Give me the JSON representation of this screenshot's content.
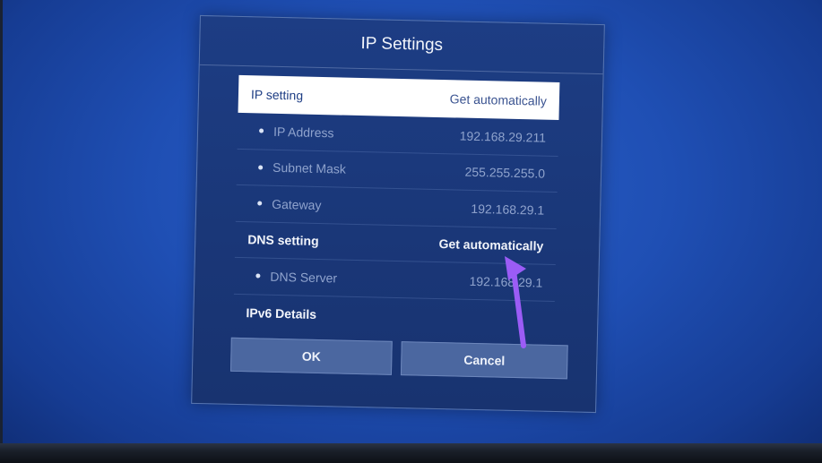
{
  "dialog": {
    "title": "IP Settings",
    "rows": [
      {
        "label": "IP setting",
        "value": "Get automatically"
      },
      {
        "label": "IP Address",
        "value": "192.168.29.211"
      },
      {
        "label": "Subnet Mask",
        "value": "255.255.255.0"
      },
      {
        "label": "Gateway",
        "value": "192.168.29.1"
      },
      {
        "label": "DNS setting",
        "value": "Get automatically"
      },
      {
        "label": "DNS Server",
        "value": "192.168.29.1"
      },
      {
        "label": "IPv6 Details",
        "value": ""
      }
    ],
    "ok_label": "OK",
    "cancel_label": "Cancel"
  },
  "colors": {
    "screen_background": "#1f4fb4",
    "dialog_background": "#1d3d84",
    "focus_highlight": "#ffffff",
    "button_background": "#4b67a0",
    "annotation_arrow": "#9b5cf6"
  }
}
